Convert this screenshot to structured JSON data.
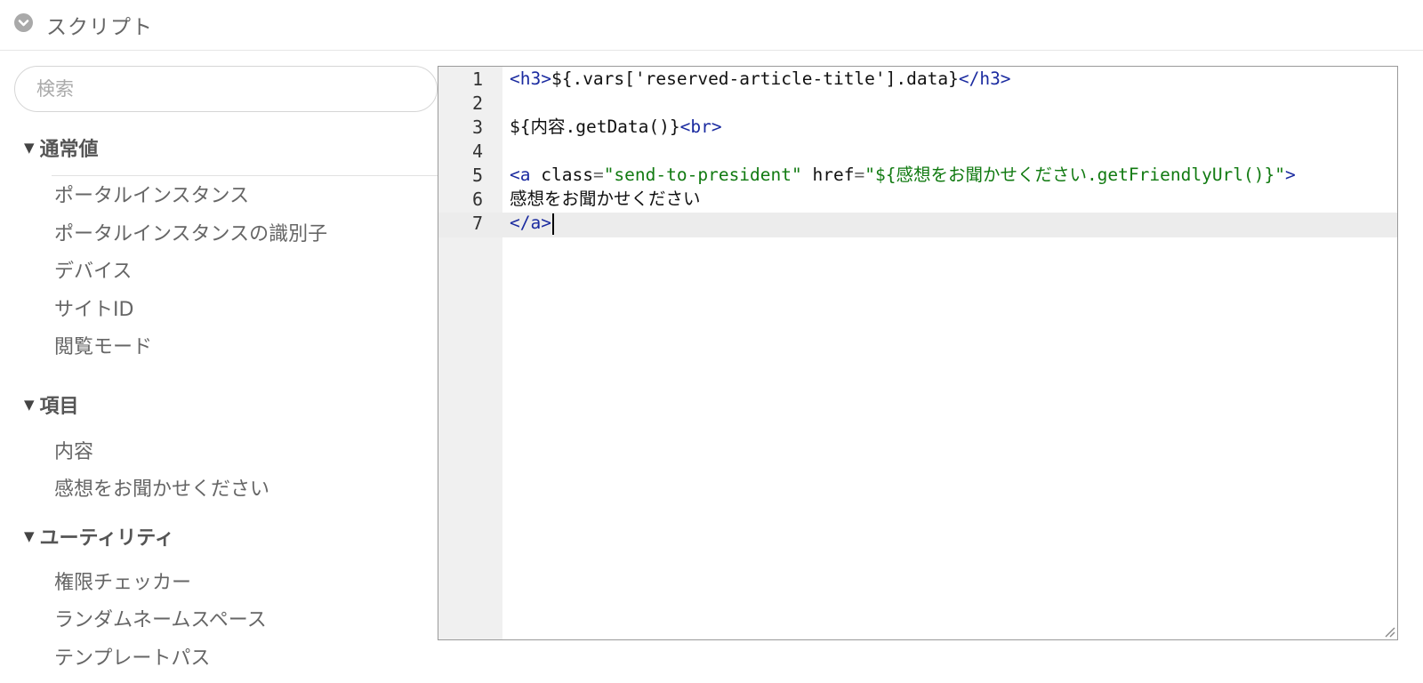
{
  "header": {
    "title": "スクリプト",
    "icon": "chevron-circle-down-icon"
  },
  "search": {
    "placeholder": "検索",
    "value": ""
  },
  "groups": [
    {
      "label": "通常値",
      "items": [
        "ポータルインスタンス",
        "ポータルインスタンスの識別子",
        "デバイス",
        "サイトID",
        "閲覧モード"
      ]
    },
    {
      "label": "項目",
      "items": [
        "内容",
        "感想をお聞かせください"
      ]
    },
    {
      "label": "ユーティリティ",
      "items": [
        "権限チェッカー",
        "ランダムネームスペース",
        "テンプレートパス"
      ]
    }
  ],
  "editor": {
    "line_numbers": [
      "1",
      "2",
      "3",
      "4",
      "5",
      "6",
      "7"
    ],
    "active_line": 7,
    "lines": {
      "l1": {
        "open_tag": "<h3>",
        "text": "${.vars['reserved-article-title'].data}",
        "close_tag": "</h3>"
      },
      "l3": {
        "text": "${内容.getData()}",
        "tag": "<br>"
      },
      "l5": {
        "open": "<a",
        "attr1_name": "class",
        "attr1_value": "\"send-to-president\"",
        "attr2_name": "href",
        "attr2_value": "\"${感想をお聞かせください.getFriendlyUrl()}\"",
        "close": ">"
      },
      "l6": {
        "text": "感想をお聞かせください"
      },
      "l7": {
        "tag": "</a>"
      }
    },
    "colors": {
      "tag": "#1b2ba0",
      "string": "#117a11",
      "text": "#111111",
      "gutter": "#f0f0f0"
    }
  }
}
